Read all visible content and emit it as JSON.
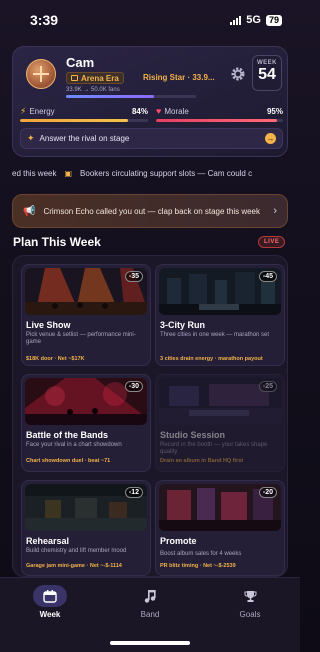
{
  "status_bar": {
    "time": "3:39",
    "network": "5G",
    "battery": "79"
  },
  "profile": {
    "name": "Cam",
    "era": "Arena Era",
    "rank": "Rising Star · 33.9...",
    "week_label": "WEEK",
    "week": "54",
    "fans_text": "33.9K → 50.0K fans",
    "fans_progress": 0.68,
    "energy_label": "Energy",
    "energy_value": "84%",
    "energy_level": 0.84,
    "morale_label": "Morale",
    "morale_value": "95%",
    "morale_level": 0.95,
    "objective": "Answer the rival on stage"
  },
  "ticker": {
    "first": "ed this week",
    "second": "Bookers circulating support slots — Cam could c"
  },
  "callout": {
    "text": "Crimson Echo called you out — clap back on stage this week"
  },
  "section": {
    "title": "Plan This Week",
    "badge": "LIVE"
  },
  "cards": [
    {
      "title": "Live Show",
      "cost": "-35",
      "desc": "Pick venue & setlist — performance mini-game",
      "meta": "$18K door · Net ~$17K"
    },
    {
      "title": "3-City Run",
      "cost": "-45",
      "desc": "Three cities in one week — marathon set",
      "meta": "3 cities drain energy · marathon payout"
    },
    {
      "title": "Battle of the Bands",
      "cost": "-30",
      "desc": "Face your rival in a chart showdown",
      "meta": "Chart showdown duel · beat ~71"
    },
    {
      "title": "Studio Session",
      "cost": "-25",
      "desc": "Record in the booth — your takes shape quality",
      "meta": "Drain an album in Band HQ first"
    },
    {
      "title": "Rehearsal",
      "cost": "-12",
      "desc": "Build chemistry and lift member mood",
      "meta": "Garage jam mini-game · Net ~-$-1114"
    },
    {
      "title": "Promote",
      "cost": "-20",
      "desc": "Boost album sales for 4 weeks",
      "meta": "PR blitz timing · Net ~-$-2539"
    }
  ],
  "tabs": [
    {
      "label": "Week",
      "icon": "calendar-icon"
    },
    {
      "label": "Band",
      "icon": "music-icon"
    },
    {
      "label": "Goals",
      "icon": "trophy-icon"
    }
  ]
}
